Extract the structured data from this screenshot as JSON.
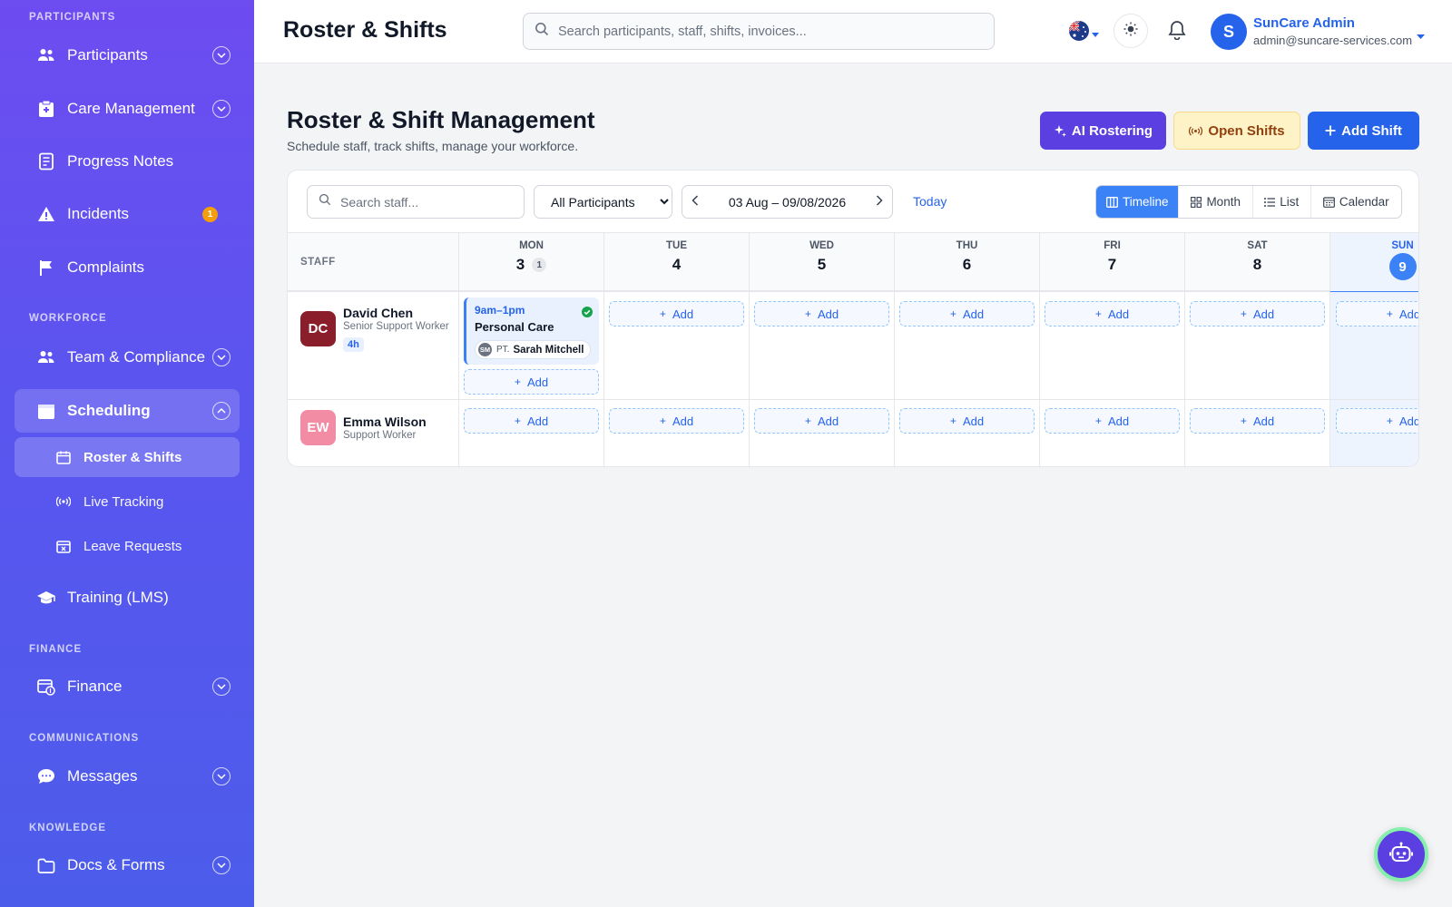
{
  "sidebar": {
    "sections": {
      "participants": "PARTICIPANTS",
      "workforce": "WORKFORCE",
      "finance": "FINANCE",
      "communications": "COMMUNICATIONS",
      "knowledge": "KNOWLEDGE"
    },
    "items": {
      "participants": "Participants",
      "care_management": "Care Management",
      "progress_notes": "Progress Notes",
      "incidents": "Incidents",
      "incidents_badge": "1",
      "complaints": "Complaints",
      "team_compliance": "Team & Compliance",
      "scheduling": "Scheduling",
      "roster_shifts": "Roster & Shifts",
      "live_tracking": "Live Tracking",
      "leave_requests": "Leave Requests",
      "training": "Training (LMS)",
      "finance": "Finance",
      "messages": "Messages",
      "docs_forms": "Docs & Forms"
    }
  },
  "header": {
    "title": "Roster & Shifts",
    "search_placeholder": "Search participants, staff, shifts, invoices...",
    "user": {
      "initial": "S",
      "name": "SunCare Admin",
      "email": "admin@suncare-services.com"
    }
  },
  "page": {
    "title": "Roster & Shift Management",
    "subtitle": "Schedule staff, track shifts, manage your workforce.",
    "buttons": {
      "ai": "AI Rostering",
      "open_shifts": "Open Shifts",
      "add_shift": "Add Shift"
    }
  },
  "toolbar": {
    "staff_search_placeholder": "Search staff...",
    "participant_filter": "All Participants",
    "date_range": "03 Aug – 09/08/2026",
    "today": "Today",
    "views": {
      "timeline": "Timeline",
      "month": "Month",
      "list": "List",
      "calendar": "Calendar"
    },
    "active_view": "Timeline"
  },
  "grid": {
    "staff_header": "STAFF",
    "add_label": "Add",
    "days": [
      {
        "name": "MON",
        "date": "3",
        "count": "1"
      },
      {
        "name": "TUE",
        "date": "4"
      },
      {
        "name": "WED",
        "date": "5"
      },
      {
        "name": "THU",
        "date": "6"
      },
      {
        "name": "FRI",
        "date": "7"
      },
      {
        "name": "SAT",
        "date": "8"
      },
      {
        "name": "SUN",
        "date": "9",
        "today": true
      }
    ],
    "staff": [
      {
        "initials": "DC",
        "name": "David Chen",
        "role": "Senior Support Worker",
        "hours": "4h",
        "color": "#8b1e2b",
        "shift": {
          "time": "9am–1pm",
          "title": "Personal Care",
          "participant_initials": "SM",
          "participant_tag": "PT.",
          "participant_name": "Sarah Mitchell",
          "status": "confirmed"
        }
      },
      {
        "initials": "EW",
        "name": "Emma Wilson",
        "role": "Support Worker",
        "color": "#f28ca5"
      }
    ]
  },
  "colors": {
    "primary": "#2563eb",
    "ai": "#5b3fe0",
    "sidebar_top": "#6d4cf0",
    "sidebar_bottom": "#4c5cea"
  }
}
